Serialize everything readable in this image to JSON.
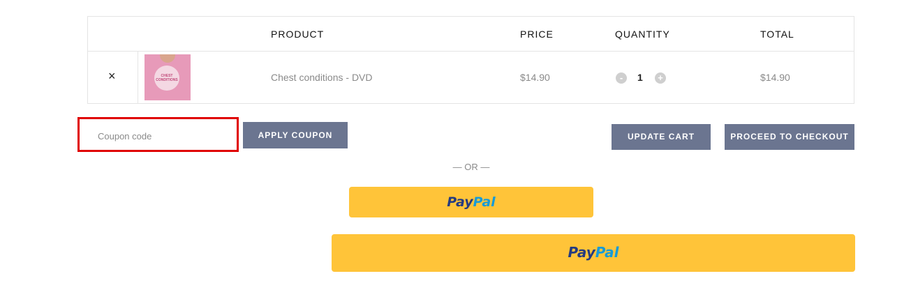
{
  "table": {
    "headers": {
      "product": "PRODUCT",
      "price": "PRICE",
      "quantity": "QUANTITY",
      "total": "TOTAL"
    },
    "rows": [
      {
        "remove_symbol": "×",
        "thumbnail_icon": "product-dvd-thumbnail",
        "thumbnail_text": "CHEST CONDITIONS",
        "product": "Chest conditions - DVD",
        "price": "$14.90",
        "qty_minus": "-",
        "quantity": "1",
        "qty_plus": "+",
        "total": "$14.90"
      }
    ]
  },
  "coupon": {
    "placeholder": "Coupon code",
    "value": "",
    "apply_label": "APPLY COUPON"
  },
  "actions": {
    "update_label": "UPDATE CART",
    "checkout_label": "PROCEED TO CHECKOUT"
  },
  "separator": "— OR —",
  "paypal": {
    "part1": "Pay",
    "part2": "Pal"
  },
  "colors": {
    "button": "#6b7590",
    "paypal_bg": "#ffc439",
    "paypal_dark": "#253b80",
    "paypal_light": "#179bd7",
    "highlight": "#e00000"
  }
}
